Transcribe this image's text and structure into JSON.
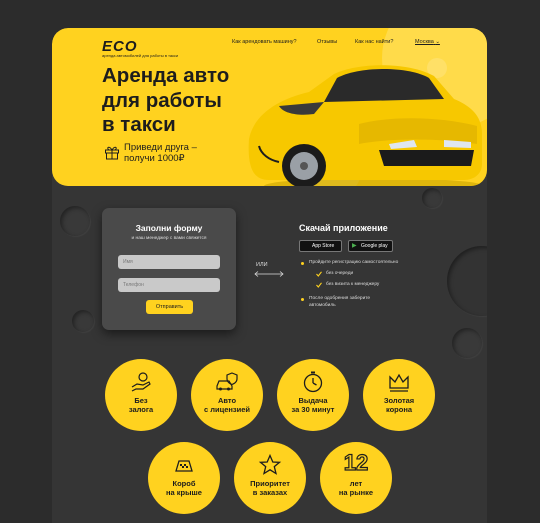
{
  "logo": {
    "mark": "ECO",
    "tagline": "аренда автомобилей для работы в такси"
  },
  "nav": {
    "items": [
      "Как арендовать машину?",
      "Отзывы",
      "Как нас найти?"
    ],
    "city": "Москва"
  },
  "hero": {
    "title_line1": "Аренда авто",
    "title_line2": "для работы",
    "title_line3": "в такси",
    "promo_line1": "Приведи друга –",
    "promo_line2": "получи 1000₽"
  },
  "form": {
    "title": "Заполни форму",
    "subtitle": "и наш менеджер с вами свяжется",
    "name_placeholder": "Имя",
    "phone_placeholder": "Телефон",
    "submit_label": "Отправить"
  },
  "or_label": "ИЛИ",
  "app": {
    "title": "Скачай приложение",
    "appstore_label": "App Store",
    "appstore_small": "Download on the",
    "googleplay_label": "Google play",
    "step1": "Пройдите регистрацию самостоятельно",
    "check1": "без очереди",
    "check2": "без визита к менеджеру",
    "step2_line1": "После одобрения заберите",
    "step2_line2": "автомобиль"
  },
  "features": [
    {
      "line1": "Без",
      "line2": "залога",
      "icon": "hand-coin-icon"
    },
    {
      "line1": "Авто",
      "line2": "с лицензией",
      "icon": "car-shield-icon"
    },
    {
      "line1": "Выдача",
      "line2": "за 30 минут",
      "icon": "stopwatch-icon"
    },
    {
      "line1": "Золотая",
      "line2": "корона",
      "icon": "crown-icon"
    },
    {
      "line1": "Короб",
      "line2": "на крыше",
      "icon": "taxi-sign-icon"
    },
    {
      "line1": "Приоритет",
      "line2": "в заказах",
      "icon": "star-icon"
    },
    {
      "line1": "лет",
      "line2": "на рынке",
      "icon": "years-number",
      "number": "12"
    }
  ],
  "colors": {
    "accent": "#ffd21f",
    "background": "#2c2c2c",
    "card": "#353535",
    "text_dark": "#1d1d1d"
  }
}
